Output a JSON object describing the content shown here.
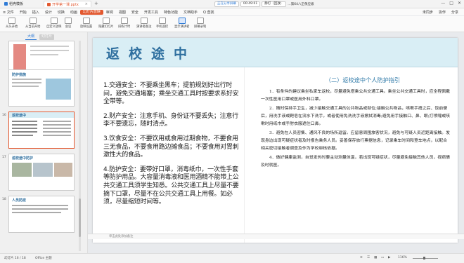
{
  "titlebar": {
    "home_tab": "稻壳模板",
    "doc_tab": "开学第一课.pptx",
    "new_tab": "+",
    "right_items": [
      "正在分享屏幕",
      "00:49:01",
      "静打（回放）",
      "…第64八正保应级"
    ],
    "window_controls": [
      "—",
      "□",
      "✕"
    ]
  },
  "menubar": {
    "items": [
      "≡ 文件",
      "开始",
      "插入",
      "设计",
      "切换",
      "动画",
      "幻灯片放映",
      "审阅",
      "视图",
      "安全",
      "开发工具",
      "特色功能",
      "文档助手",
      "Q 查找"
    ],
    "active_index": 6,
    "right_items": [
      "未同步",
      "协作",
      "分享"
    ]
  },
  "toolbar": {
    "tools": [
      "从头开始",
      "从当前开始",
      "自定义放映",
      "会议",
      "放映设置",
      "隐藏幻灯片",
      "排练计时",
      "演讲者备注",
      "手机遥控",
      "显示演讲者",
      "屏幕录制"
    ],
    "highlight_index": 9
  },
  "left_pane": {
    "tabs": [
      "大纲",
      "幻灯片"
    ],
    "slide_numbers": [
      "",
      "",
      "16",
      "17",
      "18"
    ],
    "thumb_titles": [
      "",
      "防护措施",
      "返校途中",
      "返校途中防护",
      "人员防疫"
    ]
  },
  "slide": {
    "title": "返校途中",
    "left_points": [
      "1.交通安全：不要乘坐黑车；提前规划好出行时间，避免交通堵塞；乘坐交通工具时按要求系好安全带等。",
      "2.财产安全：注意手机、身份证不要丢失；注意行李不要遗忘，随时清点。",
      "3.饮食安全：不要饮用或食用过期食物，不要食用三无食品，不要食用路边摊食品；不要食用对胃刺激性大的食品。",
      "4.防护安全：要带好口罩，消毒纸巾，一次性手套等防护用品。大容量消毒液和医用酒精不能带上公共交通工具须学生知悉。公共交通工具上尽量不要摘下口罩，尽量不在公共交通工具上用餐。如必须，尽量缩短时间等。"
    ],
    "right_title": "（二）返校途中个人防护指引",
    "right_points": [
      "1．有条件的建议乘坐私家车返校，尽量避免搭乘公共交通工具。乘坐公共交通工具时，应全程佩戴一次性医用口罩或医用外科口罩。",
      "2．随时保持手卫生，减少接触交通工具的公共物品或部位;接触公共物品，咳嗽手捂之后、饭前便后，用洗手液或靶皂在流水下洗手，或者使用免洗洗手液擦拭消毒;避免用手接触口、鼻、眼;打喷嚏或咳嗽时用纸巾或手肘衣服遮住口鼻。",
      "3．避免在人员密集、通风不良的场所逗留。应留意周围旅客状况，避免与可疑人员近距离接触。发现身边出现可疑症状者及时报告乘务人员。妥善保存旅行票据信息，记录乘车时间和登车地点，以配合相关密切接触者调查及作为学校审核依据。",
      "4．做好健康监测，自觉发热时要主动测量体温，若出现可疑症状，尽量避免接触其他人员，视病情及时就医。"
    ]
  },
  "notes": {
    "placeholder": "单击此处添加备注"
  },
  "statusbar": {
    "slide_info": "幻灯片 16 / 18",
    "theme": "Office 主题",
    "zoom": "116%",
    "view_icons": [
      "≡",
      "☰",
      "▦",
      "▭",
      "▶"
    ]
  }
}
